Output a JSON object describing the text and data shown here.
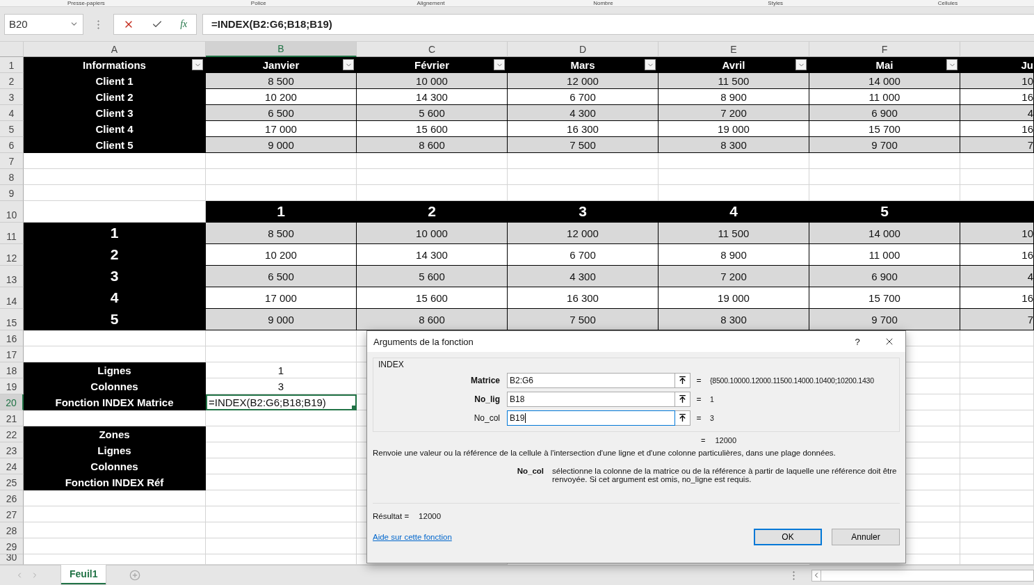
{
  "ribbon_groups": [
    "Presse-papiers",
    "Police",
    "Alignement",
    "Nombre",
    "Styles",
    "Cellules"
  ],
  "name_box": "B20",
  "fx_label": "fx",
  "formula_bar": {
    "value": "=INDEX(B2:G6;B18;B19)"
  },
  "columns": [
    {
      "label": "A",
      "selected": false
    },
    {
      "label": "B",
      "selected": true
    },
    {
      "label": "C",
      "selected": false
    },
    {
      "label": "D",
      "selected": false
    },
    {
      "label": "E",
      "selected": false
    },
    {
      "label": "F",
      "selected": false
    }
  ],
  "rows": [
    {
      "number": "1",
      "kind": "normal",
      "selected": false,
      "cells": [
        {
          "text": "Informations",
          "kind": "head",
          "filter": true
        },
        {
          "text": "Janvier",
          "kind": "head",
          "filter": true
        },
        {
          "text": "Février",
          "kind": "head",
          "filter": true
        },
        {
          "text": "Mars",
          "kind": "head",
          "filter": true
        },
        {
          "text": "Avril",
          "kind": "head",
          "filter": true
        },
        {
          "text": "Mai",
          "kind": "head",
          "filter": true
        },
        {
          "text": "Ju",
          "kind": "head",
          "filter": false
        }
      ]
    },
    {
      "number": "2",
      "kind": "normal",
      "selected": false,
      "cells": [
        {
          "text": "Client 1",
          "kind": "head"
        },
        {
          "text": "8 500",
          "kind": "shade"
        },
        {
          "text": "10 000",
          "kind": "shade"
        },
        {
          "text": "12 000",
          "kind": "shade"
        },
        {
          "text": "11 500",
          "kind": "shade"
        },
        {
          "text": "14 000",
          "kind": "shade"
        },
        {
          "text": "10",
          "kind": "shade"
        }
      ]
    },
    {
      "number": "3",
      "kind": "normal",
      "selected": false,
      "cells": [
        {
          "text": "Client 2",
          "kind": "head"
        },
        {
          "text": "10 200",
          "kind": "plain"
        },
        {
          "text": "14 300",
          "kind": "plain"
        },
        {
          "text": "6 700",
          "kind": "plain"
        },
        {
          "text": "8 900",
          "kind": "plain"
        },
        {
          "text": "11 000",
          "kind": "plain"
        },
        {
          "text": "16",
          "kind": "plain"
        }
      ]
    },
    {
      "number": "4",
      "kind": "normal",
      "selected": false,
      "cells": [
        {
          "text": "Client 3",
          "kind": "head"
        },
        {
          "text": "6 500",
          "kind": "shade"
        },
        {
          "text": "5 600",
          "kind": "shade"
        },
        {
          "text": "4 300",
          "kind": "shade"
        },
        {
          "text": "7 200",
          "kind": "shade"
        },
        {
          "text": "6 900",
          "kind": "shade"
        },
        {
          "text": "4",
          "kind": "shade"
        }
      ]
    },
    {
      "number": "5",
      "kind": "normal",
      "selected": false,
      "cells": [
        {
          "text": "Client 4",
          "kind": "head"
        },
        {
          "text": "17 000",
          "kind": "plain"
        },
        {
          "text": "15 600",
          "kind": "plain"
        },
        {
          "text": "16 300",
          "kind": "plain"
        },
        {
          "text": "19 000",
          "kind": "plain"
        },
        {
          "text": "15 700",
          "kind": "plain"
        },
        {
          "text": "16",
          "kind": "plain"
        }
      ]
    },
    {
      "number": "6",
      "kind": "normal",
      "selected": false,
      "cells": [
        {
          "text": "Client 5",
          "kind": "head"
        },
        {
          "text": "9 000",
          "kind": "shade"
        },
        {
          "text": "8 600",
          "kind": "shade"
        },
        {
          "text": "7 500",
          "kind": "shade"
        },
        {
          "text": "8 300",
          "kind": "shade"
        },
        {
          "text": "9 700",
          "kind": "shade"
        },
        {
          "text": "7",
          "kind": "shade"
        }
      ]
    },
    {
      "number": "7",
      "kind": "normal",
      "selected": false,
      "cells": []
    },
    {
      "number": "8",
      "kind": "normal",
      "selected": false,
      "cells": []
    },
    {
      "number": "9",
      "kind": "normal",
      "selected": false,
      "cells": []
    },
    {
      "number": "10",
      "kind": "tall",
      "selected": false,
      "cells": [
        {
          "kind": "blank"
        },
        {
          "text": "1",
          "kind": "big"
        },
        {
          "text": "2",
          "kind": "big"
        },
        {
          "text": "3",
          "kind": "big"
        },
        {
          "text": "4",
          "kind": "big"
        },
        {
          "text": "5",
          "kind": "big"
        },
        {
          "kind": "big"
        }
      ]
    },
    {
      "number": "11",
      "kind": "tall",
      "selected": false,
      "cells": [
        {
          "text": "1",
          "kind": "big"
        },
        {
          "text": "8 500",
          "kind": "shade"
        },
        {
          "text": "10 000",
          "kind": "shade"
        },
        {
          "text": "12 000",
          "kind": "shade"
        },
        {
          "text": "11 500",
          "kind": "shade"
        },
        {
          "text": "14 000",
          "kind": "shade"
        },
        {
          "text": "10",
          "kind": "shade"
        }
      ]
    },
    {
      "number": "12",
      "kind": "tall",
      "selected": false,
      "cells": [
        {
          "text": "2",
          "kind": "big"
        },
        {
          "text": "10 200",
          "kind": "plain"
        },
        {
          "text": "14 300",
          "kind": "plain"
        },
        {
          "text": "6 700",
          "kind": "plain"
        },
        {
          "text": "8 900",
          "kind": "plain"
        },
        {
          "text": "11 000",
          "kind": "plain"
        },
        {
          "text": "16",
          "kind": "plain"
        }
      ]
    },
    {
      "number": "13",
      "kind": "tall",
      "selected": false,
      "cells": [
        {
          "text": "3",
          "kind": "big"
        },
        {
          "text": "6 500",
          "kind": "shade"
        },
        {
          "text": "5 600",
          "kind": "shade"
        },
        {
          "text": "4 300",
          "kind": "shade"
        },
        {
          "text": "7 200",
          "kind": "shade"
        },
        {
          "text": "6 900",
          "kind": "shade"
        },
        {
          "text": "4",
          "kind": "shade"
        }
      ]
    },
    {
      "number": "14",
      "kind": "tall",
      "selected": false,
      "cells": [
        {
          "text": "4",
          "kind": "big"
        },
        {
          "text": "17 000",
          "kind": "plain"
        },
        {
          "text": "15 600",
          "kind": "plain"
        },
        {
          "text": "16 300",
          "kind": "plain"
        },
        {
          "text": "19 000",
          "kind": "plain"
        },
        {
          "text": "15 700",
          "kind": "plain"
        },
        {
          "text": "16",
          "kind": "plain"
        }
      ]
    },
    {
      "number": "15",
      "kind": "tall",
      "selected": false,
      "cells": [
        {
          "text": "5",
          "kind": "big"
        },
        {
          "text": "9 000",
          "kind": "shade"
        },
        {
          "text": "8 600",
          "kind": "shade"
        },
        {
          "text": "7 500",
          "kind": "shade"
        },
        {
          "text": "8 300",
          "kind": "shade"
        },
        {
          "text": "9 700",
          "kind": "shade"
        },
        {
          "text": "7",
          "kind": "shade"
        }
      ]
    },
    {
      "number": "16",
      "kind": "normal",
      "selected": false,
      "cells": []
    },
    {
      "number": "17",
      "kind": "normal",
      "selected": false,
      "cells": []
    },
    {
      "number": "18",
      "kind": "normal",
      "selected": false,
      "cells": [
        {
          "text": "Lignes",
          "kind": "head"
        },
        {
          "text": "1",
          "kind": "value"
        }
      ]
    },
    {
      "number": "19",
      "kind": "normal",
      "selected": false,
      "cells": [
        {
          "text": "Colonnes",
          "kind": "head"
        },
        {
          "text": "3",
          "kind": "value"
        }
      ]
    },
    {
      "number": "20",
      "kind": "normal",
      "selected": true,
      "cells": [
        {
          "text": "Fonction INDEX Matrice",
          "kind": "head"
        },
        {
          "text": "=INDEX(B2:G6;B18;B19)",
          "kind": "active"
        }
      ]
    },
    {
      "number": "21",
      "kind": "normal",
      "selected": false,
      "cells": []
    },
    {
      "number": "22",
      "kind": "normal",
      "selected": false,
      "cells": [
        {
          "text": "Zones",
          "kind": "head"
        }
      ]
    },
    {
      "number": "23",
      "kind": "normal",
      "selected": false,
      "cells": [
        {
          "text": "Lignes",
          "kind": "head"
        }
      ]
    },
    {
      "number": "24",
      "kind": "normal",
      "selected": false,
      "cells": [
        {
          "text": "Colonnes",
          "kind": "head"
        }
      ]
    },
    {
      "number": "25",
      "kind": "normal",
      "selected": false,
      "cells": [
        {
          "text": "Fonction INDEX Réf",
          "kind": "head"
        }
      ]
    },
    {
      "number": "26",
      "kind": "normal",
      "selected": false,
      "cells": []
    },
    {
      "number": "27",
      "kind": "normal",
      "selected": false,
      "cells": []
    },
    {
      "number": "28",
      "kind": "normal",
      "selected": false,
      "cells": []
    },
    {
      "number": "29",
      "kind": "normal",
      "selected": false,
      "cells": []
    },
    {
      "number": "30",
      "kind": "cut",
      "selected": false,
      "cells": []
    }
  ],
  "dialog": {
    "title": "Arguments de la fonction",
    "help": "?",
    "group": "INDEX",
    "arguments": [
      {
        "label": "Matrice",
        "bold": true,
        "value": "B2:G6",
        "equals": "=",
        "result": "{8500.10000.12000.11500.14000.10400;10200.1430",
        "focused": false
      },
      {
        "label": "No_lig",
        "bold": true,
        "value": "B18",
        "equals": "=",
        "result": "1",
        "focused": false
      },
      {
        "label": "No_col",
        "bold": false,
        "value": "B19",
        "equals": "=",
        "result": "3",
        "focused": true
      }
    ],
    "formula_result": {
      "equals": "=",
      "value": "12000"
    },
    "description": "Renvoie une valeur ou la référence de la cellule à l'intersection d'une ligne et d'une colonne particulières, dans une plage données.",
    "argument_help": {
      "name": "No_col",
      "text": "sélectionne la colonne de la matrice ou de la référence à partir de laquelle une référence doit être renvoyée. Si cet argument est omis, no_ligne est requis."
    },
    "result_label": "Résultat =",
    "result_value": "12000",
    "help_link": "Aide sur cette fonction",
    "buttons": [
      {
        "label": "OK",
        "default": true
      },
      {
        "label": "Annuler",
        "default": false
      }
    ]
  },
  "sheet_tabs": [
    {
      "label": "Feuil1",
      "selected": true
    }
  ]
}
